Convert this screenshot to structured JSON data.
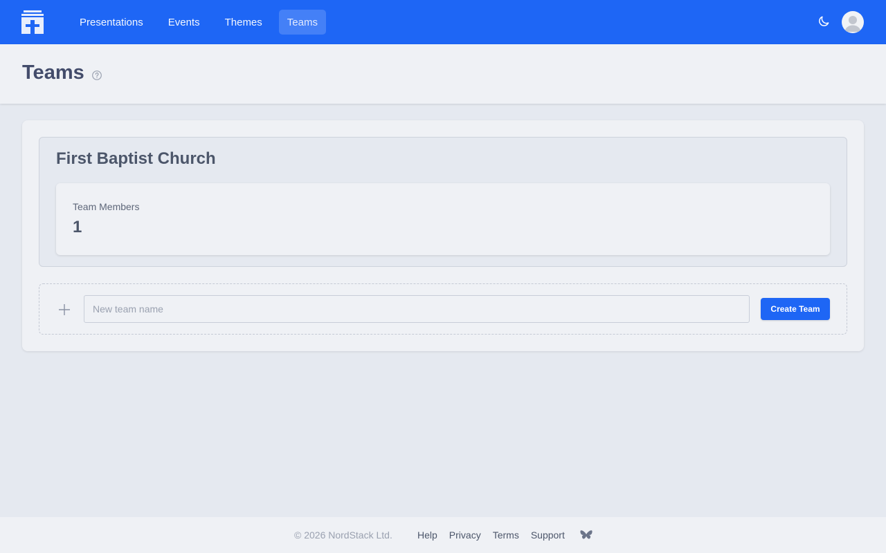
{
  "nav": {
    "items": [
      {
        "label": "Presentations",
        "active": false
      },
      {
        "label": "Events",
        "active": false
      },
      {
        "label": "Themes",
        "active": false
      },
      {
        "label": "Teams",
        "active": true
      }
    ],
    "theme_toggle_icon": "moon-icon",
    "avatar_icon": "user-avatar-icon",
    "brand_color": "#1e66f5"
  },
  "header": {
    "title": "Teams",
    "help_icon": "question-circle-icon"
  },
  "team": {
    "name": "First Baptist Church",
    "stat_label": "Team Members",
    "stat_value": "1"
  },
  "create": {
    "icon": "plus-icon",
    "placeholder": "New team name",
    "value": "",
    "button_label": "Create Team"
  },
  "footer": {
    "copyright": "© 2026 NordStack Ltd.",
    "links": [
      "Help",
      "Privacy",
      "Terms",
      "Support"
    ],
    "social_icon": "butterfly-icon"
  }
}
